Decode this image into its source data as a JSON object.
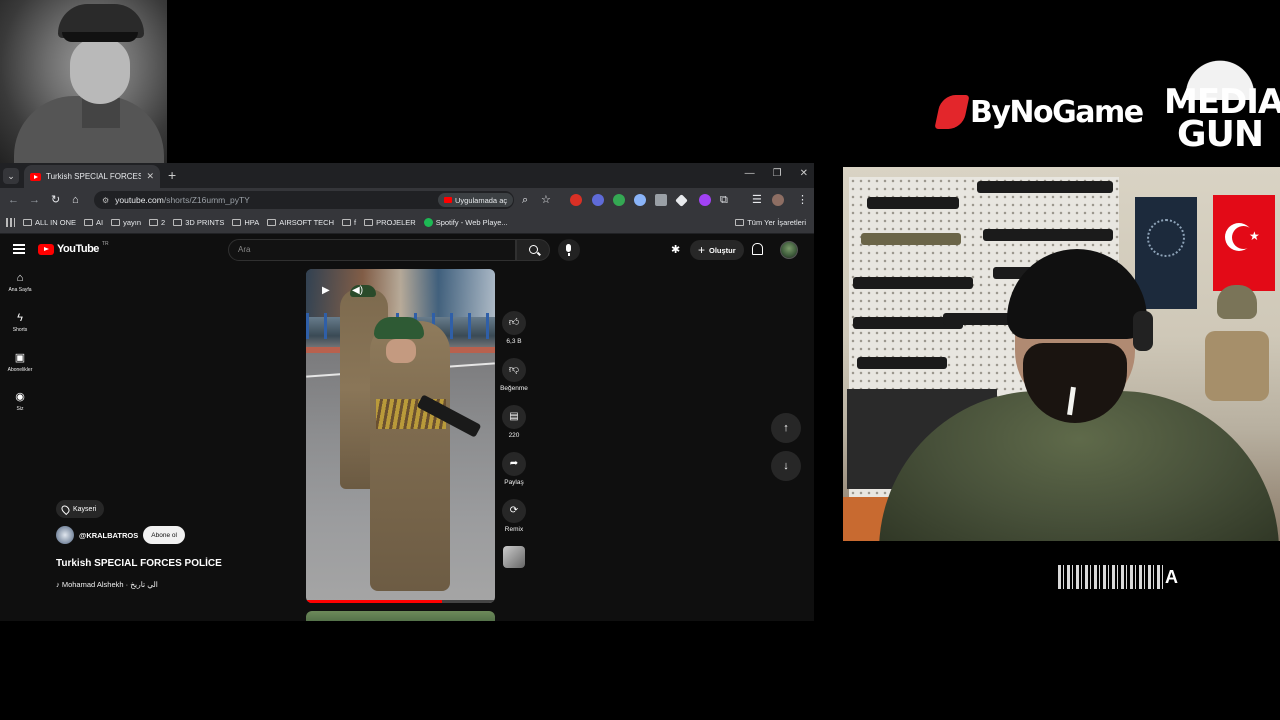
{
  "browser": {
    "tab_title": "Turkish SPECIAL FORCES POLİCE",
    "url_host": "youtube.com",
    "url_path": "/shorts/Z16umm_pyTY",
    "open_in_app": "Uygulamada aç",
    "bookmarks": [
      "ALL IN ONE",
      "AI",
      "yayın",
      "2",
      "3D PRINTS",
      "HPA",
      "AIRSOFT TECH",
      "f",
      "PROJELER",
      "Spotify - Web Playe..."
    ],
    "all_bookmarks": "Tüm Yer İşaretleri"
  },
  "youtube": {
    "logo": "YouTube",
    "region": "TR",
    "search_placeholder": "Ara",
    "create_label": "Oluştur",
    "sidebar": [
      {
        "label": "Ana Sayfa",
        "icon": "home-icon"
      },
      {
        "label": "Shorts",
        "icon": "shorts-icon"
      },
      {
        "label": "Abonelikler",
        "icon": "subscriptions-icon"
      },
      {
        "label": "Siz",
        "icon": "profile-icon"
      }
    ],
    "short": {
      "location": "Kayseri",
      "channel": "@KRALBATROS",
      "subscribe": "Abone ol",
      "title": "Turkish SPECIAL FORCES POLİCE",
      "sound": "♪ Mohamad Alshekh · الي تاريخ"
    },
    "actions": {
      "likes": "6,3 B",
      "dislike": "Beğenme",
      "comments": "220",
      "share": "Paylaş",
      "remix": "Remix"
    },
    "progress_fraction": 0.72
  },
  "branding": {
    "bynogame": "ByNoGame",
    "media_top": "MEDIA",
    "media_bottom": "GUN",
    "bynogame_color": "#e3262b"
  },
  "overlay": {
    "letter": "A"
  }
}
